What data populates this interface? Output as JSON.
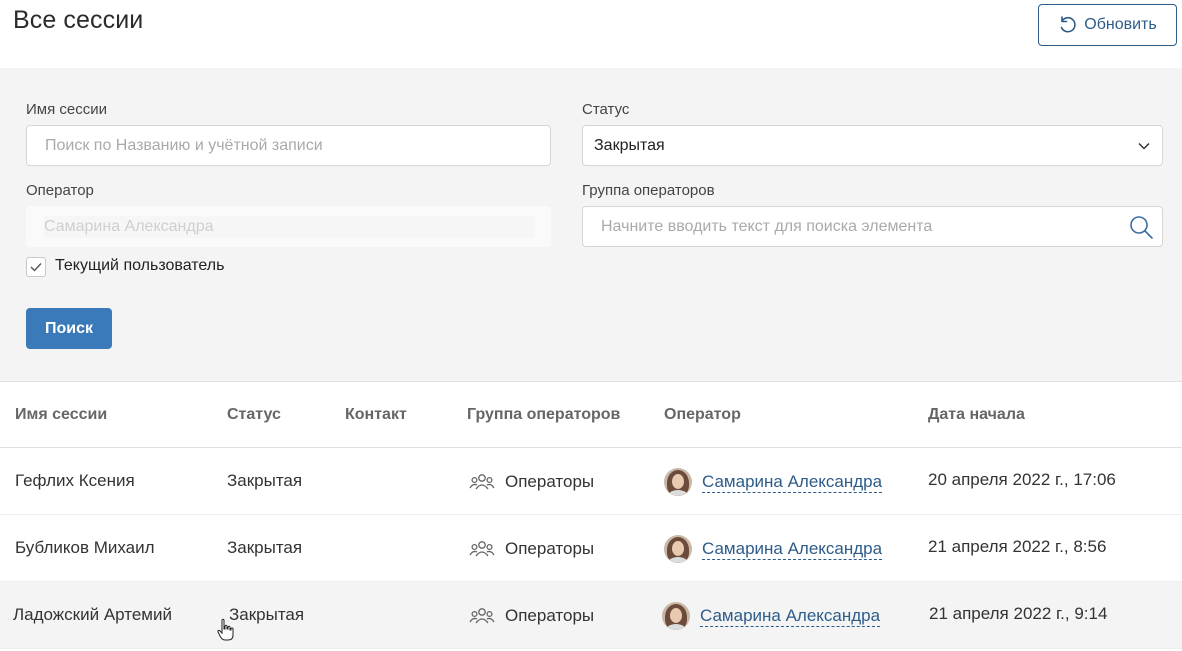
{
  "header": {
    "title": "Все сессии",
    "refresh_label": "Обновить"
  },
  "filters": {
    "session_name_label": "Имя сессии",
    "session_name_placeholder": "Поиск по Названию и учётной записи",
    "status_label": "Статус",
    "status_value": "Закрытая",
    "operator_label": "Оператор",
    "operator_value": "Самарина Александра",
    "group_label": "Группа операторов",
    "group_placeholder": "Начните вводить текст для поиска элемента",
    "current_user_label": "Текущий пользователь",
    "current_user_checked": true,
    "search_button": "Поиск"
  },
  "table": {
    "columns": [
      "Имя сессии",
      "Статус",
      "Контакт",
      "Группа операторов",
      "Оператор",
      "Дата начала"
    ],
    "rows": [
      {
        "name": "Гефлих Ксения",
        "status": "Закрытая",
        "contact": "",
        "group": "Операторы",
        "operator": "Самарина Александра",
        "date": "20 апреля 2022 г., 17:06"
      },
      {
        "name": "Бубликов Михаил",
        "status": "Закрытая",
        "contact": "",
        "group": "Операторы",
        "operator": "Самарина Александра",
        "date": "21 апреля 2022 г., 8:56"
      },
      {
        "name": "Ладожский Артемий",
        "status": "Закрытая",
        "contact": "",
        "group": "Операторы",
        "operator": "Самарина Александра",
        "date": "21 апреля 2022 г., 9:14"
      }
    ]
  },
  "icons": {
    "refresh": "refresh-icon",
    "chevron": "chevron-down-icon",
    "search": "search-icon",
    "check": "check-icon",
    "group": "users-group-icon",
    "cursor": "hand-cursor-icon"
  },
  "colors": {
    "accent": "#2e5c8a",
    "button": "#3a7ab8",
    "panel": "#f4f4f4"
  }
}
